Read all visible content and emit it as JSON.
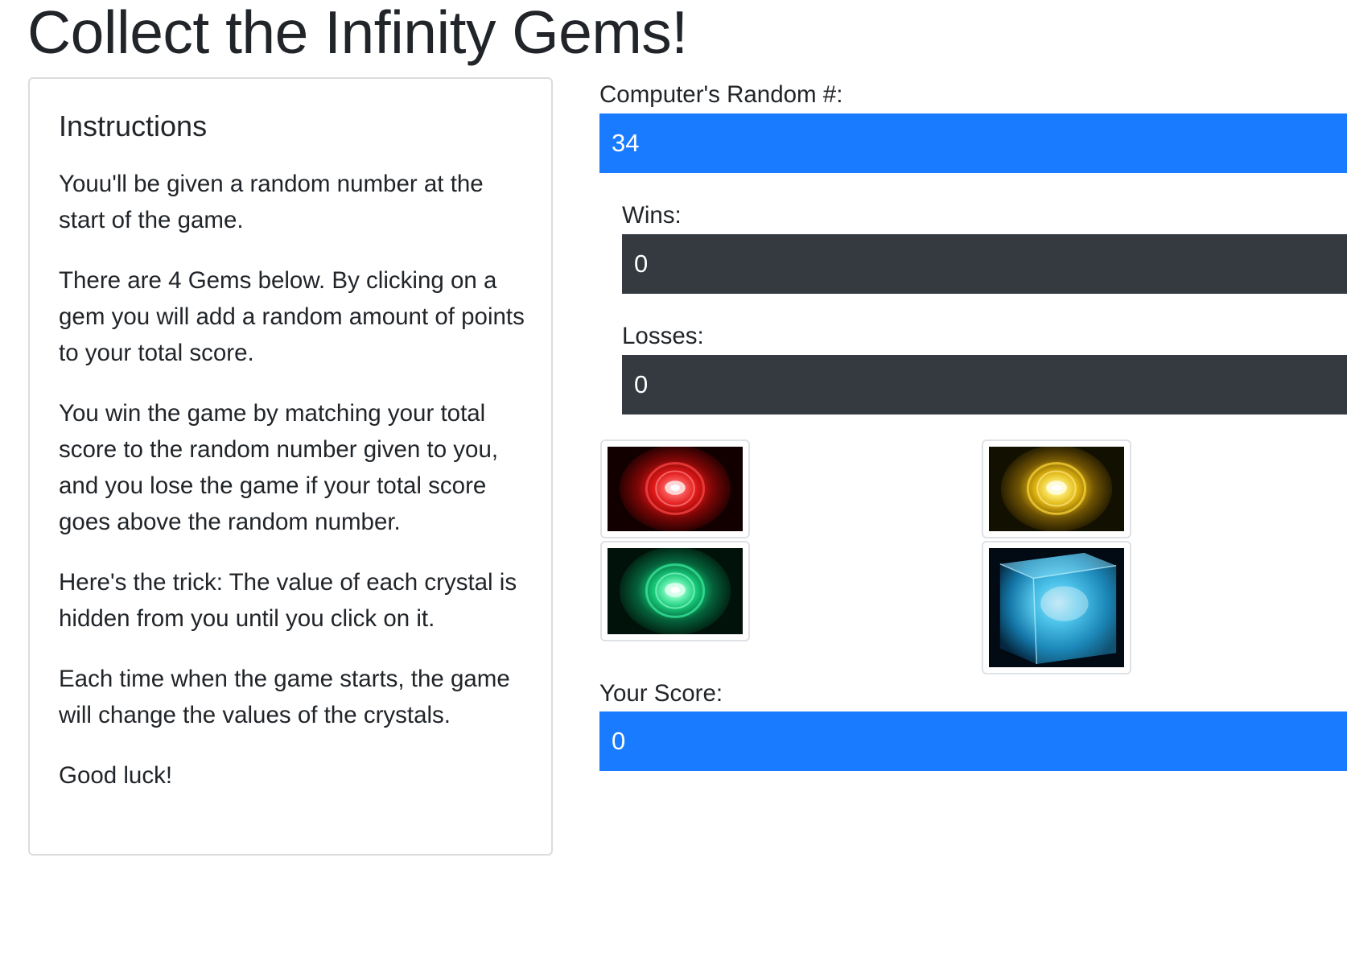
{
  "page": {
    "title": "Collect the Infinity Gems!"
  },
  "instructions": {
    "heading": "Instructions",
    "paragraphs": [
      "Youu'll be given a random number at the start of the game.",
      "There are 4 Gems below. By clicking on a gem you will add a random amount of points to your total score.",
      "You win the game by matching your total score to the random number given to you, and you lose the game if your total score goes above the random number.",
      "Here's the trick: The value of each crystal is hidden from you until you click on it.",
      "Each time when the game starts, the game will change the values of the crystals.",
      "Good luck!"
    ]
  },
  "stats": {
    "random_label": "Computer's Random #:",
    "random_value": "34",
    "wins_label": "Wins:",
    "wins_value": "0",
    "losses_label": "Losses:",
    "losses_value": "0",
    "score_label": "Your Score:",
    "score_value": "0"
  },
  "gems": [
    {
      "name": "red-gem",
      "icon": "red-infinity-stone",
      "color": "#ff2a2a"
    },
    {
      "name": "yellow-gem",
      "icon": "yellow-infinity-stone",
      "color": "#ffd21a"
    },
    {
      "name": "green-gem",
      "icon": "green-infinity-stone",
      "color": "#1ee08a"
    },
    {
      "name": "blue-gem",
      "icon": "tesseract-cube",
      "color": "#3ec9f0"
    }
  ],
  "colors": {
    "primary": "#197bff",
    "dark": "#353a40",
    "text": "#212529",
    "card_border": "#dcdcdc"
  }
}
